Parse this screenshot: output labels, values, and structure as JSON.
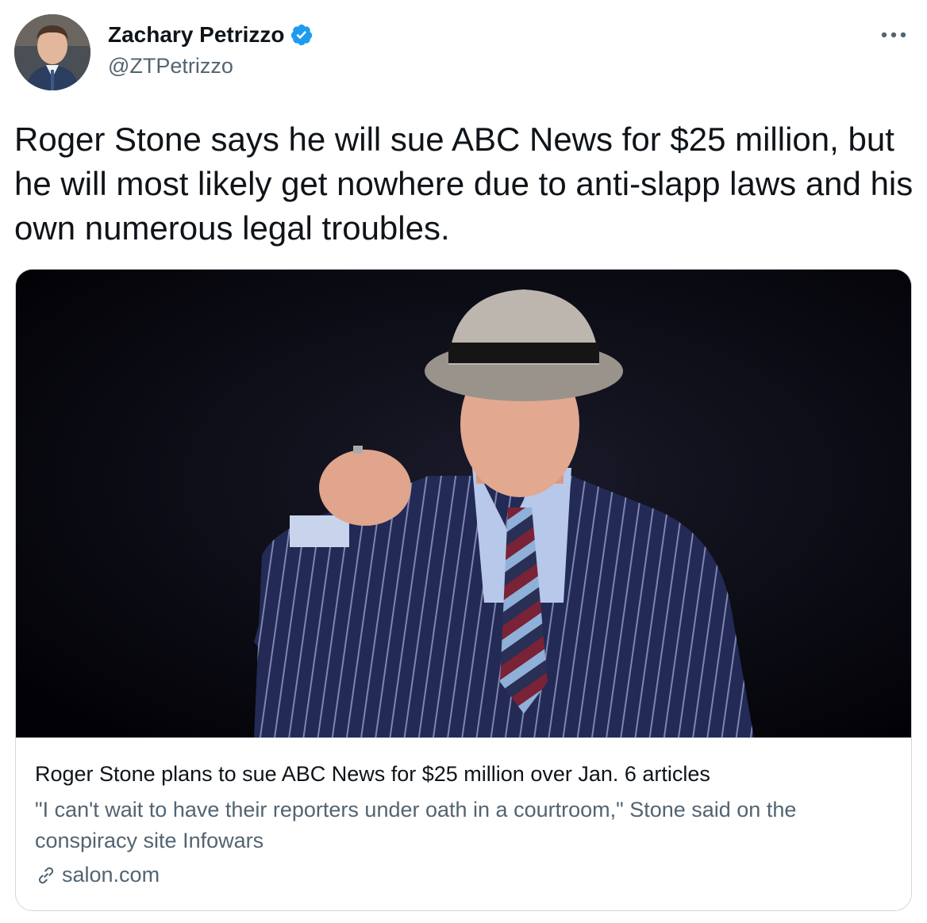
{
  "author": {
    "display_name": "Zachary Petrizzo",
    "handle": "@ZTPetrizzo",
    "verified": true
  },
  "tweet": {
    "text": "Roger Stone says he will sue ABC News for $25 million, but he will most likely get nowhere due to anti-slapp laws and his own numerous legal troubles."
  },
  "card": {
    "title": "Roger Stone plans to sue ABC News for $25 million over Jan. 6 articles",
    "description": "\"I can't wait to have their reporters under oath in a courtroom,\" Stone said on the conspiracy site Infowars",
    "domain": "salon.com"
  },
  "icons": {
    "verified": "verified-badge-icon",
    "more": "more-icon",
    "link": "link-icon"
  },
  "colors": {
    "accent": "#1d9bf0",
    "text": "#0f1419",
    "secondary": "#536471",
    "border": "#cfd9de"
  }
}
